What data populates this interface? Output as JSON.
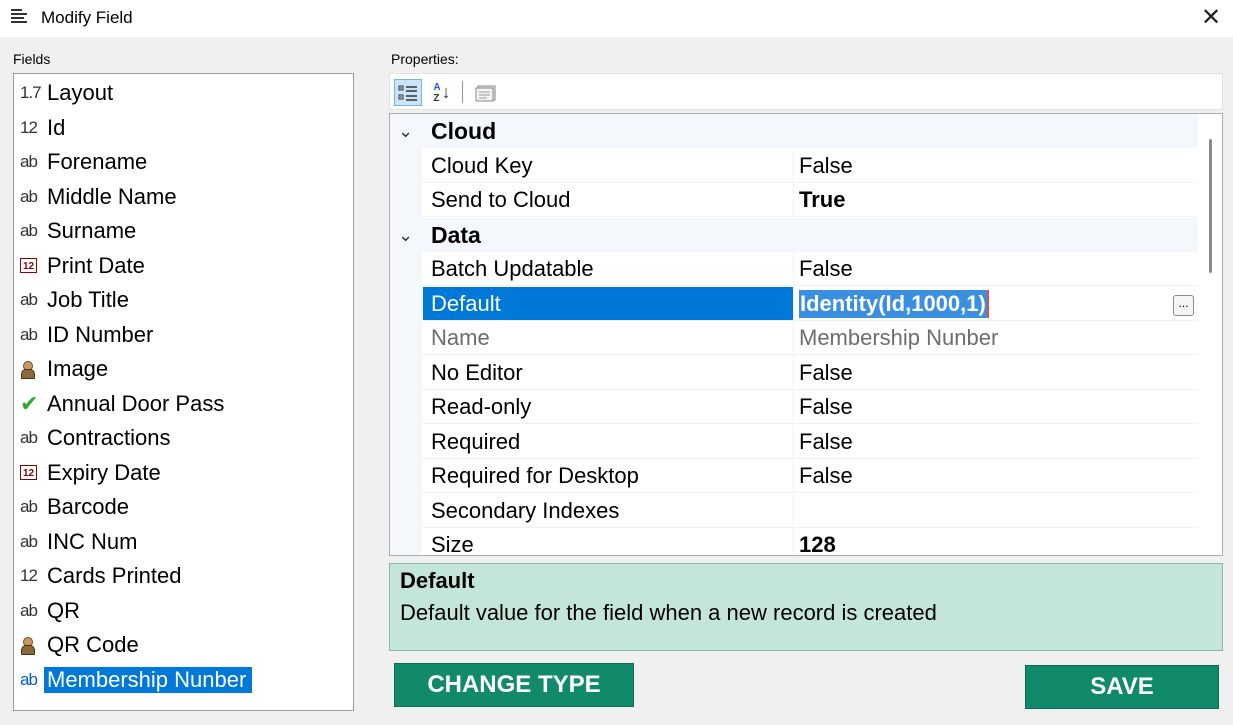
{
  "window": {
    "title": "Modify Field",
    "close_glyph": "✕",
    "icon": "list-lines-icon"
  },
  "fields_panel": {
    "label": "Fields",
    "items": [
      {
        "icon": "1.7",
        "icon_type": "decimal-icon",
        "name": "Layout"
      },
      {
        "icon": "12",
        "icon_type": "integer-icon",
        "name": "Id"
      },
      {
        "icon": "ab",
        "icon_type": "text-icon",
        "name": "Forename"
      },
      {
        "icon": "ab",
        "icon_type": "text-icon",
        "name": "Middle Name"
      },
      {
        "icon": "ab",
        "icon_type": "text-icon",
        "name": "Surname"
      },
      {
        "icon": "12",
        "icon_type": "calendar-icon",
        "name": "Print Date"
      },
      {
        "icon": "ab",
        "icon_type": "text-icon",
        "name": "Job Title"
      },
      {
        "icon": "ab",
        "icon_type": "text-icon",
        "name": "ID Number"
      },
      {
        "icon": "",
        "icon_type": "image-icon",
        "name": "Image"
      },
      {
        "icon": "✔",
        "icon_type": "checkmark-icon",
        "name": "Annual Door Pass"
      },
      {
        "icon": "ab",
        "icon_type": "text-icon",
        "name": "Contractions"
      },
      {
        "icon": "12",
        "icon_type": "calendar-icon",
        "name": "Expiry Date"
      },
      {
        "icon": "ab",
        "icon_type": "text-icon",
        "name": "Barcode"
      },
      {
        "icon": "ab",
        "icon_type": "text-icon",
        "name": "INC Num"
      },
      {
        "icon": "12",
        "icon_type": "integer-icon",
        "name": "Cards Printed"
      },
      {
        "icon": "ab",
        "icon_type": "text-icon",
        "name": "QR"
      },
      {
        "icon": "",
        "icon_type": "image-icon",
        "name": "QR Code"
      },
      {
        "icon": "ab",
        "icon_type": "text-icon",
        "name": "Membership Nunber",
        "selected": true
      }
    ]
  },
  "properties_panel": {
    "label": "Properties:",
    "toolbar": {
      "categorized_icon": "categorized-view-icon",
      "alphabetical_icon": "sort-alphabetical-icon",
      "alpha_top": "A",
      "alpha_bottom": "Z",
      "alpha_arrow": "↓",
      "pages_icon": "property-pages-icon"
    },
    "categories": [
      {
        "name": "Cloud",
        "chevron": "⌄",
        "rows": [
          {
            "label": "Cloud Key",
            "value": "False"
          },
          {
            "label": "Send to Cloud",
            "value": "True",
            "bold": true
          }
        ]
      },
      {
        "name": "Data",
        "chevron": "⌄",
        "rows": [
          {
            "label": "Batch Updatable",
            "value": "False"
          },
          {
            "label": "Default",
            "value": "Identity(Id,1000,1)",
            "selected": true,
            "editing": true
          },
          {
            "label": "Name",
            "value": "Membership Nunber",
            "disabled": true
          },
          {
            "label": "No Editor",
            "value": "False"
          },
          {
            "label": "Read-only",
            "value": "False"
          },
          {
            "label": "Required",
            "value": "False"
          },
          {
            "label": "Required for Desktop",
            "value": "False"
          },
          {
            "label": "Secondary Indexes",
            "value": ""
          },
          {
            "label": "Size",
            "value": "128",
            "bold": true
          }
        ]
      }
    ],
    "ellipsis_label": "...",
    "description": {
      "title": "Default",
      "text": "Default value for the field when a new record is created"
    }
  },
  "buttons": {
    "change_type": "CHANGE TYPE",
    "save": "SAVE"
  },
  "colors": {
    "accent": "#0078d7",
    "button_green": "#118a6c",
    "description_bg": "#c4e5dc"
  }
}
